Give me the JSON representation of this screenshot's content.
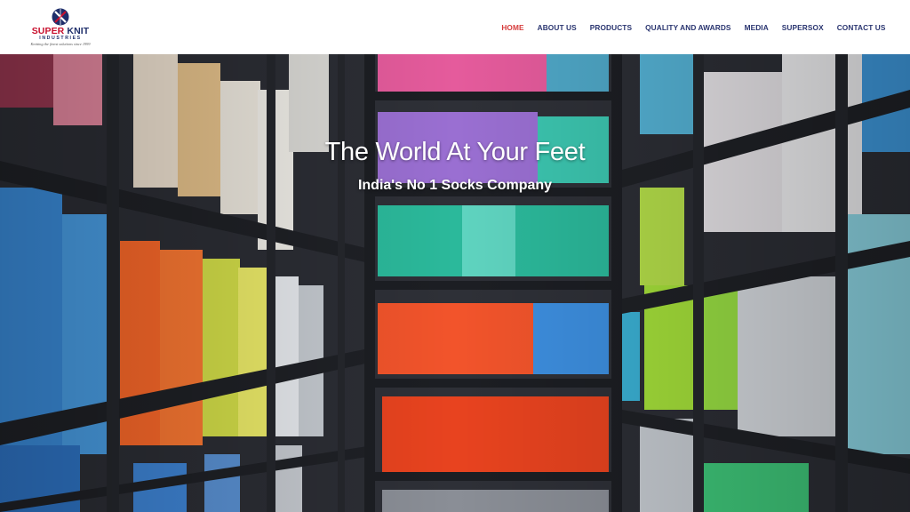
{
  "header": {
    "logo": {
      "name_part1": "SUPER",
      "name_part2": "KNIT",
      "name_sub": "INDUSTRIES",
      "tagline": "Knitting the finest solutions since 1999",
      "icon": "superknit-logo-mark",
      "colors": {
        "red": "#c8102e",
        "navy": "#1f2f6b"
      }
    },
    "nav": [
      {
        "label": "HOME",
        "active": true
      },
      {
        "label": "ABOUT US",
        "active": false
      },
      {
        "label": "PRODUCTS",
        "active": false
      },
      {
        "label": "QUALITY AND AWARDS",
        "active": false
      },
      {
        "label": "MEDIA",
        "active": false
      },
      {
        "label": "SUPERSOX",
        "active": false
      },
      {
        "label": "CONTACT US",
        "active": false
      }
    ],
    "active_color": "#d63b3b",
    "nav_color": "#2a3570"
  },
  "hero": {
    "title": "The World At Your Feet",
    "subtitle": "India's No 1 Socks Company",
    "background": "warehouse-shelves-with-colorful-yarn-cones"
  }
}
